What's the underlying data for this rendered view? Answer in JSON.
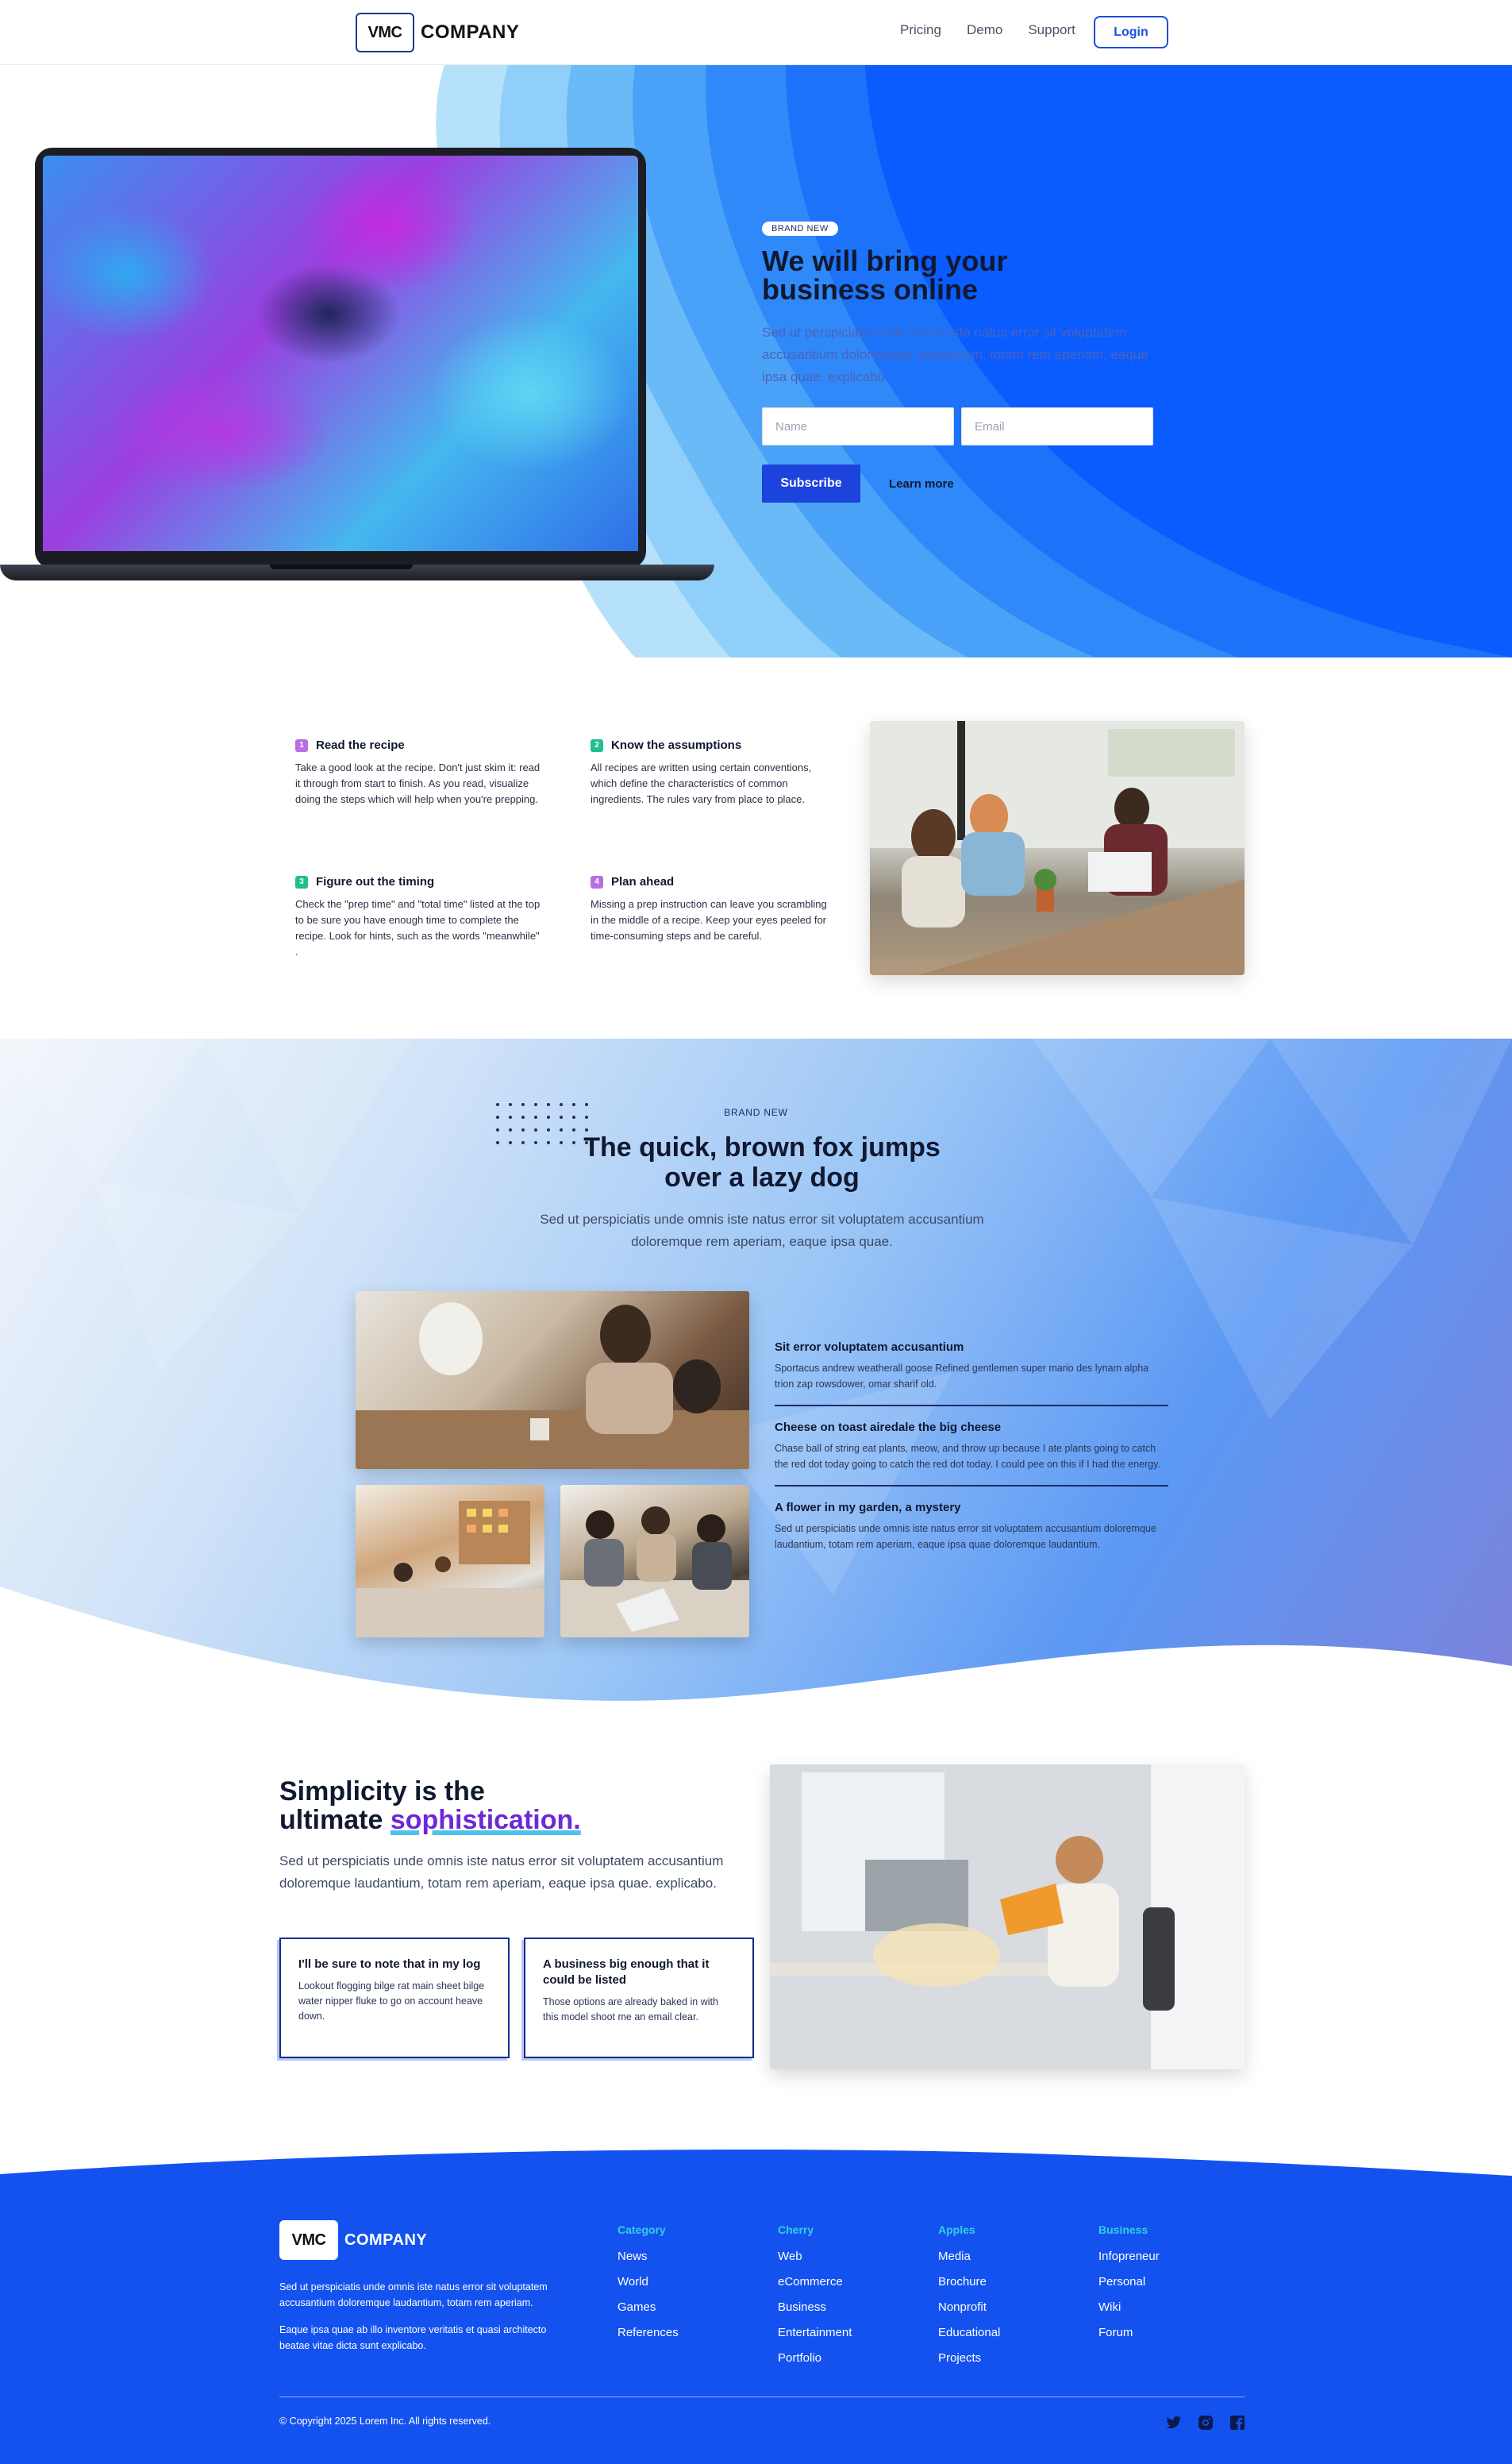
{
  "nav": {
    "logo_mark": "VMC",
    "logo_text": "COMPANY",
    "links": [
      "Pricing",
      "Demo",
      "Support"
    ],
    "login_label": "Login"
  },
  "hero": {
    "badge": "BRAND NEW",
    "title_line1": "We will bring your",
    "title_line2": "business online",
    "subtitle": "Sed ut perspiciatis unde omnis iste natus error sit voluptatem accusantium doloremque laudantium, totam rem aperiam, eaque ipsa quae. explicabo.",
    "name_placeholder": "Name",
    "email_placeholder": "Email",
    "subscribe_label": "Subscribe",
    "learn_more_label": "Learn more"
  },
  "steps": [
    {
      "num": "1",
      "title": "Read the recipe",
      "text": "Take a good look at the recipe. Don't just skim it: read it through from start to finish. As you read, visualize doing the steps which will help when you're prepping.",
      "color": "#b86fe6"
    },
    {
      "num": "2",
      "title": "Know the assumptions",
      "text": "All recipes are written using certain conventions, which define the characteristics of common ingredients. The rules vary from place to place.",
      "color": "#1fbf8f"
    },
    {
      "num": "3",
      "title": "Figure out the timing",
      "text": "Check the \"prep time\" and \"total time\" listed at the top to be sure you have enough time to complete the recipe. Look for hints, such as the words \"meanwhile\" .",
      "color": "#1fbf8f"
    },
    {
      "num": "4",
      "title": "Plan ahead",
      "text": "Missing a prep instruction can leave you scrambling in the middle of a recipe. Keep your eyes peeled for time-consuming steps and be careful.",
      "color": "#b86fe6"
    }
  ],
  "fox": {
    "badge": "BRAND NEW",
    "title_line1": "The quick, brown fox jumps",
    "title_line2": "over a lazy dog",
    "subtitle": "Sed ut perspiciatis unde omnis iste natus error sit voluptatem accusantium doloremque rem aperiam, eaque ipsa quae.",
    "features": [
      {
        "title": "Sit error voluptatem accusantium",
        "text": "Sportacus andrew weatherall goose Refined gentlemen super mario des lynam alpha trion zap rowsdower, omar sharif old."
      },
      {
        "title": "Cheese on toast airedale the big cheese",
        "text": "Chase ball of string eat plants, meow, and throw up because I ate plants going to catch the red dot today going to catch the red dot today. I could pee on this if I had the energy."
      },
      {
        "title": "A flower in my garden, a mystery",
        "text": "Sed ut perspiciatis unde omnis iste natus error sit voluptatem accusantium doloremque laudantium, totam rem aperiam, eaque ipsa quae doloremque laudantium."
      }
    ]
  },
  "simplicity": {
    "title_line1": "Simplicity is the",
    "title_line2_plain": "ultimate ",
    "title_line2_highlight": "sophistication.",
    "subtitle": "Sed ut perspiciatis unde omnis iste natus error sit voluptatem accusantium doloremque laudantium, totam rem aperiam, eaque ipsa quae. explicabo.",
    "cards": [
      {
        "title": "I'll be sure to note that in my log",
        "text": "Lookout flogging bilge rat main sheet bilge water nipper fluke to go on account heave down."
      },
      {
        "title": "A business big enough that it could be listed",
        "text": "Those options are already baked in with this model shoot me an email clear."
      }
    ]
  },
  "footer": {
    "logo_mark": "VMC",
    "logo_text": "COMPANY",
    "about_1": "Sed ut perspiciatis unde omnis iste natus error sit voluptatem accusantium doloremque laudantium, totam rem aperiam.",
    "about_2": "Eaque ipsa quae ab illo inventore veritatis et quasi architecto beatae vitae dicta sunt explicabo.",
    "columns": [
      {
        "title": "Category",
        "items": [
          "News",
          "World",
          "Games",
          "References"
        ]
      },
      {
        "title": "Cherry",
        "items": [
          "Web",
          "eCommerce",
          "Business",
          "Entertainment",
          "Portfolio"
        ]
      },
      {
        "title": "Apples",
        "items": [
          "Media",
          "Brochure",
          "Nonprofit",
          "Educational",
          "Projects"
        ]
      },
      {
        "title": "Business",
        "items": [
          "Infopreneur",
          "Personal",
          "Wiki",
          "Forum"
        ]
      }
    ],
    "copyright": "© Copyright 2025 Lorem Inc. All rights reserved.",
    "social": [
      "twitter-icon",
      "instagram-icon",
      "facebook-icon"
    ]
  },
  "colors": {
    "primary": "#1c43dc",
    "hero_blue": "#0a5cff",
    "footer_blue": "#1452f0",
    "accent_cyan": "#2fd0e6",
    "highlight_purple": "#6d28d9"
  }
}
